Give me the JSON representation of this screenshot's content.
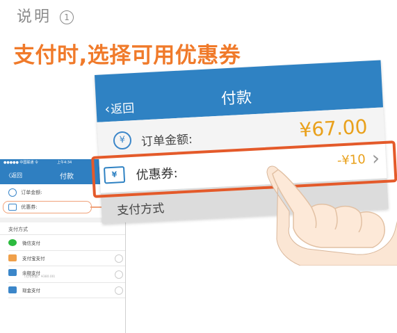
{
  "note": {
    "title": "说明",
    "number": "1"
  },
  "headline": "支付时,选择可用优惠券",
  "phone": {
    "status_carrier": "●●●●● 中国联通 令",
    "status_time": "上午4:34",
    "back_label": "〈返回",
    "title": "付款",
    "order_label": "订单金额:",
    "coupon_label": "优惠券:",
    "pay_methods_title": "支付方式",
    "pay_methods": [
      {
        "label": "微信支付",
        "sub": "",
        "color": "#2dbb3f"
      },
      {
        "label": "支付宝支付",
        "sub": "",
        "color": "#f0a04a"
      },
      {
        "label": "余额支付",
        "sub": "（可用余额：¥380.00）",
        "color": "#3b86c9"
      },
      {
        "label": "现金支付",
        "sub": "",
        "color": "#3b86c9"
      }
    ]
  },
  "card": {
    "back_label": "返回",
    "title": "付款",
    "order_label": "订单金额:",
    "order_amount": "¥67.00",
    "coupon_icon": "¥",
    "coupon_label": "优惠券:",
    "coupon_amount": "-¥10",
    "pay_methods_title": "支付方式"
  },
  "colors": {
    "accent_blue": "#2f82c3",
    "headline_orange": "#f07a2a",
    "highlight_red": "#e45a2a",
    "amount_yellow": "#e9a11c"
  },
  "icons": {
    "order": "yen-circle-icon",
    "coupon": "ticket-icon",
    "pointer": "pointing-hand-icon"
  }
}
